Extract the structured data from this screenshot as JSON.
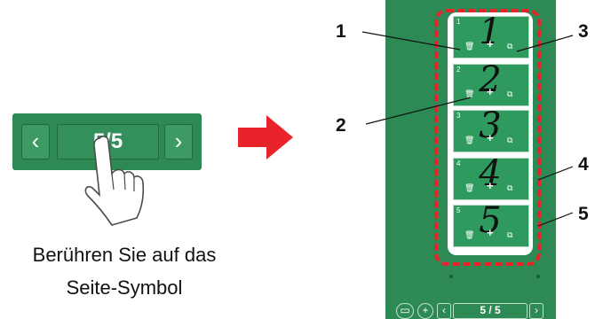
{
  "pager": {
    "prev_icon": "‹",
    "page_count": "5/5",
    "next_icon": "›"
  },
  "caption": {
    "line1": "Berühren Sie auf das",
    "line2": "Seite-Symbol"
  },
  "thumbnails": [
    {
      "number": "1",
      "digit": "1"
    },
    {
      "number": "2",
      "digit": "2"
    },
    {
      "number": "3",
      "digit": "3"
    },
    {
      "number": "4",
      "digit": "4"
    },
    {
      "number": "5",
      "digit": "5"
    }
  ],
  "thumb_icons": {
    "delete": "🗑",
    "add": "+",
    "duplicate": "⧉"
  },
  "bottom_bar": {
    "prev_icon": "‹",
    "page_count": "5 / 5",
    "next_icon": "›",
    "add_icon": "+"
  },
  "callouts": [
    "1",
    "2",
    "3",
    "4",
    "5"
  ],
  "colors": {
    "panel_green": "#2e8a55",
    "highlight_red": "#e8232a",
    "arrow_red": "#e8232a"
  },
  "icons": [
    "chevron-left-icon",
    "chevron-right-icon",
    "hand-pointer-icon",
    "arrow-right-icon",
    "trash-icon",
    "plus-icon",
    "duplicate-icon",
    "image-icon"
  ]
}
